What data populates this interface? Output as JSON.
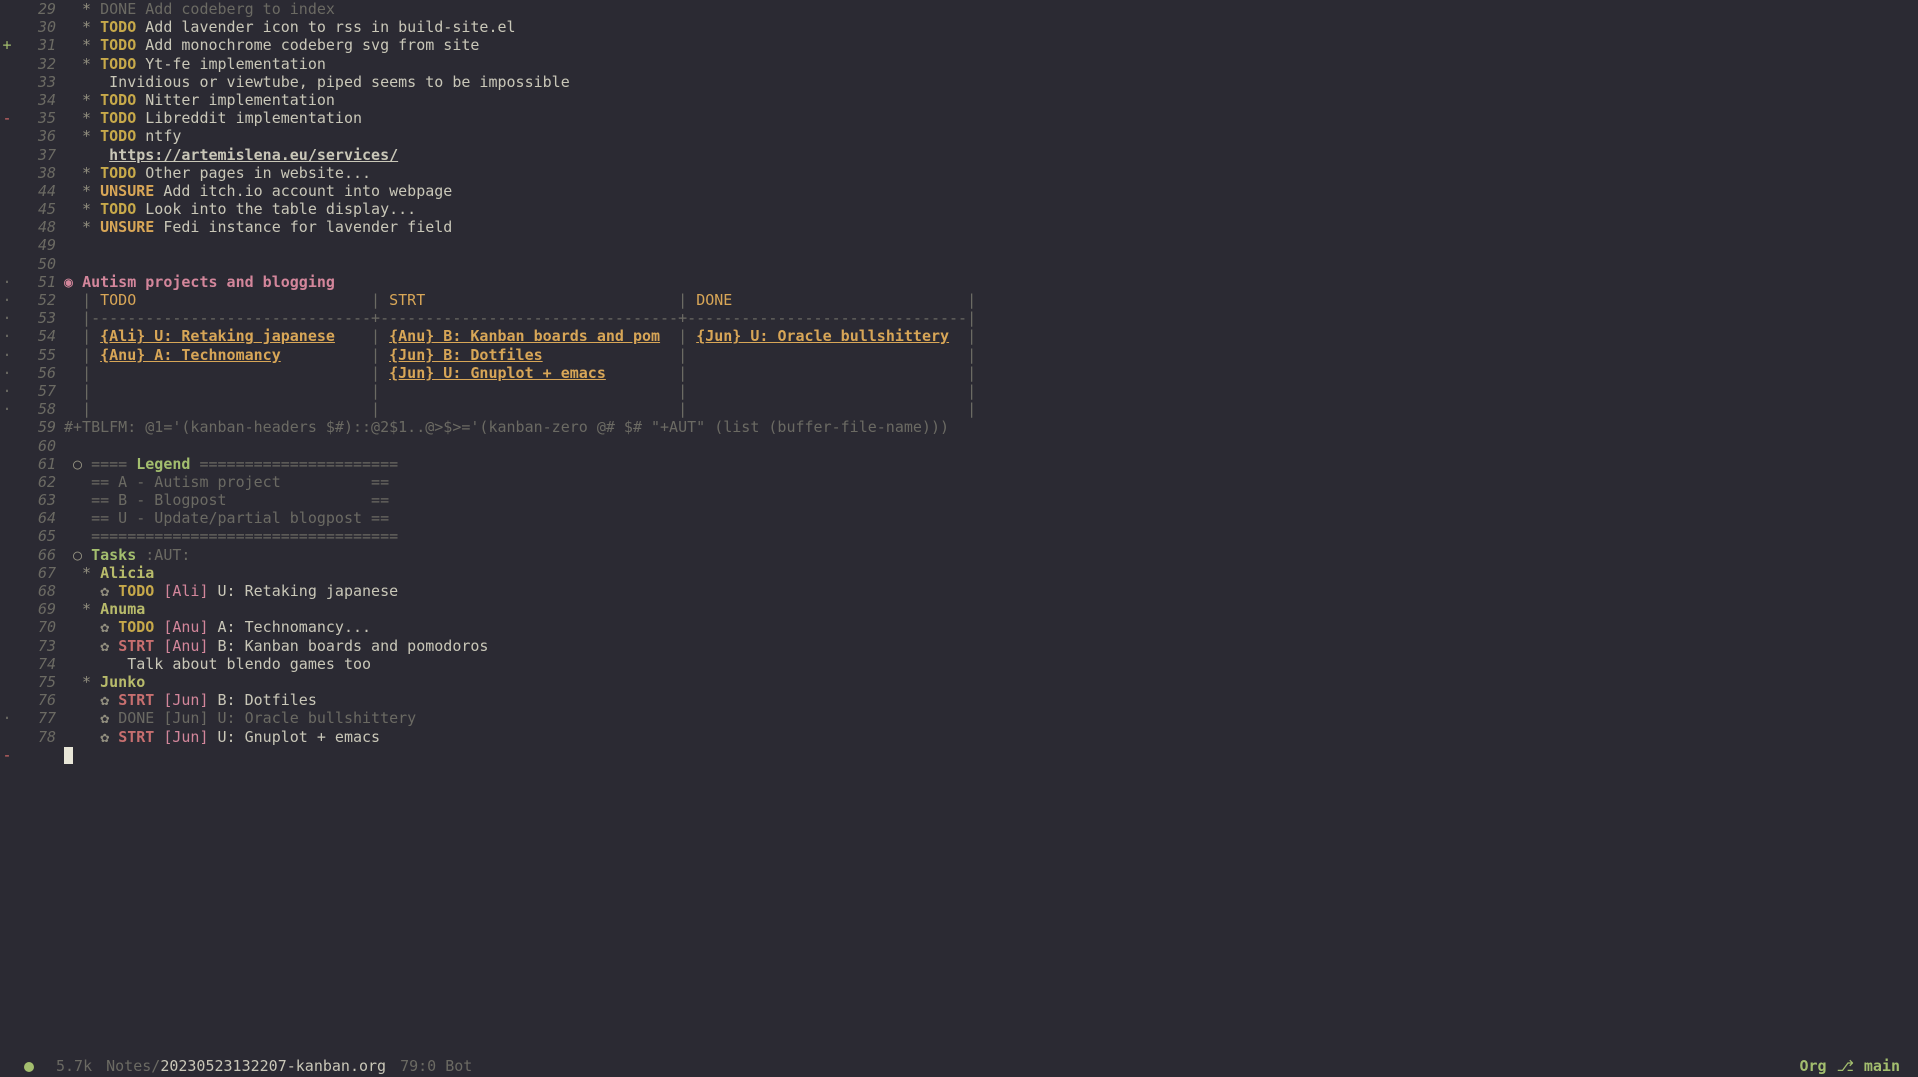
{
  "modeline": {
    "size": "5.7k",
    "path_prefix": "Notes/",
    "filename": "20230523132207-kanban.org",
    "position": "79:0 Bot",
    "mode": "Org",
    "branch": "main"
  },
  "lines": [
    {
      "num": "29",
      "diff": "",
      "bullet": "*",
      "kw": "DONE",
      "kwcls": "done",
      "text": "Add codeberg to index",
      "textcls": "done"
    },
    {
      "num": "30",
      "diff": "",
      "bullet": "*",
      "kw": "TODO",
      "kwcls": "todo",
      "text": "Add lavender icon to rss in build-site.el"
    },
    {
      "num": "31",
      "diff": "add",
      "bullet": "*",
      "kw": "TODO",
      "kwcls": "todo",
      "text": "Add monochrome codeberg svg from site"
    },
    {
      "num": "32",
      "diff": "",
      "bullet": "*",
      "kw": "TODO",
      "kwcls": "todo",
      "text": "Yt-fe implementation"
    },
    {
      "num": "33",
      "diff": "",
      "plain": "     Invidious or viewtube, piped seems to be impossible"
    },
    {
      "num": "34",
      "diff": "",
      "bullet": "*",
      "kw": "TODO",
      "kwcls": "todo",
      "text": "Nitter implementation"
    },
    {
      "num": "35",
      "diff": "del",
      "bullet": "*",
      "kw": "TODO",
      "kwcls": "todo",
      "text": "Libreddit implementation"
    },
    {
      "num": "36",
      "diff": "",
      "bullet": "*",
      "kw": "TODO",
      "kwcls": "todo",
      "text": "ntfy"
    },
    {
      "num": "37",
      "diff": "",
      "linkonly": "https://artemislena.eu/services/"
    },
    {
      "num": "38",
      "diff": "",
      "bullet": "*",
      "kw": "TODO",
      "kwcls": "todo",
      "text": "Other pages in website..."
    },
    {
      "num": "44",
      "diff": "",
      "bullet": "*",
      "kw": "UNSURE",
      "kwcls": "unsure",
      "text": "Add itch.io account into webpage"
    },
    {
      "num": "45",
      "diff": "",
      "bullet": "*",
      "kw": "TODO",
      "kwcls": "todo",
      "text": "Look into the table display..."
    },
    {
      "num": "48",
      "diff": "",
      "bullet": "*",
      "kw": "UNSURE",
      "kwcls": "unsure",
      "text": "Fedi instance for lavender field"
    },
    {
      "num": "49",
      "diff": "",
      "plain": ""
    },
    {
      "num": "50",
      "diff": "",
      "plain": ""
    },
    {
      "num": "51",
      "diff": "chg",
      "heading": "Autism projects and blogging",
      "bulletchar": "◉"
    },
    {
      "num": "52",
      "diff": "chg",
      "table": [
        "| ",
        "TODO",
        "                          | ",
        "STRT",
        "                            | ",
        "DONE",
        "                          |"
      ]
    },
    {
      "num": "53",
      "diff": "chg",
      "tablerule": "|-------------------------------+---------------------------------+-------------------------------|"
    },
    {
      "num": "54",
      "diff": "chg",
      "tablerow": [
        {
          "t": "| "
        },
        {
          "t": "{Ali} U: Retaking japanese",
          "l": true
        },
        {
          "t": "    | "
        },
        {
          "t": "{Anu} B: Kanban boards and pom",
          "l": true
        },
        {
          "t": "  | "
        },
        {
          "t": "{Jun} U: Oracle bullshittery",
          "l": true
        },
        {
          "t": "  |"
        }
      ]
    },
    {
      "num": "55",
      "diff": "chg",
      "tablerow": [
        {
          "t": "| "
        },
        {
          "t": "{Anu} A: Technomancy",
          "l": true
        },
        {
          "t": "          | "
        },
        {
          "t": "{Jun} B: Dotfiles",
          "l": true
        },
        {
          "t": "               |                               |"
        }
      ]
    },
    {
      "num": "56",
      "diff": "chg",
      "tablerow": [
        {
          "t": "|                               | "
        },
        {
          "t": "{Jun} U: Gnuplot + emacs",
          "l": true
        },
        {
          "t": "        |                               |"
        }
      ]
    },
    {
      "num": "57",
      "diff": "chg",
      "tablerow": [
        {
          "t": "|                               |                                 |                               |"
        }
      ]
    },
    {
      "num": "58",
      "diff": "chg",
      "tablerow": [
        {
          "t": "|                               |                                 |                               |"
        }
      ]
    },
    {
      "num": "59",
      "diff": "",
      "tblfm": "#+TBLFM: @1='(kanban-headers $#)::@2$1..@>$>='(kanban-zero @# $# \"+AUT\" (list (buffer-file-name)))"
    },
    {
      "num": "60",
      "diff": "",
      "plain": ""
    },
    {
      "num": "61",
      "diff": "",
      "legend_head": {
        "b": "○",
        "pre": "====",
        "title": "Legend",
        "post": "======================"
      }
    },
    {
      "num": "62",
      "diff": "",
      "legend": "   == A - Autism project          =="
    },
    {
      "num": "63",
      "diff": "",
      "legend": "   == B - Blogpost                =="
    },
    {
      "num": "64",
      "diff": "",
      "legend": "   == U - Update/partial blogpost =="
    },
    {
      "num": "65",
      "diff": "",
      "legend": "   =================================="
    },
    {
      "num": "66",
      "diff": "",
      "tasks_head": {
        "b": "○",
        "title": "Tasks",
        "tag": ":AUT:"
      }
    },
    {
      "num": "67",
      "diff": "",
      "bullet": "*",
      "star_green": true,
      "name": "Alicia"
    },
    {
      "num": "68",
      "diff": "",
      "sub": {
        "kw": "TODO",
        "kwcls": "todo",
        "tag": "[Ali]",
        "rest": "U: Retaking japanese"
      }
    },
    {
      "num": "69",
      "diff": "",
      "bullet": "*",
      "star_green": true,
      "name": "Anuma"
    },
    {
      "num": "70",
      "diff": "",
      "sub": {
        "kw": "TODO",
        "kwcls": "todo",
        "tag": "[Anu]",
        "rest": "A: Technomancy..."
      }
    },
    {
      "num": "73",
      "diff": "",
      "sub": {
        "kw": "STRT",
        "kwcls": "strt",
        "tag": "[Anu]",
        "rest": "B: Kanban boards and pomodoros"
      }
    },
    {
      "num": "74",
      "diff": "",
      "plain": "       Talk about blendo games too"
    },
    {
      "num": "75",
      "diff": "",
      "bullet": "*",
      "star_green": true,
      "name": "Junko"
    },
    {
      "num": "76",
      "diff": "",
      "sub": {
        "kw": "STRT",
        "kwcls": "strt",
        "tag": "[Jun]",
        "rest": "B: Dotfiles"
      }
    },
    {
      "num": "77",
      "diff": "chg",
      "sub": {
        "kw": "DONE",
        "kwcls": "done",
        "tag": "[Jun]",
        "rest": "U: Oracle bullshittery",
        "dim": true
      }
    },
    {
      "num": "78",
      "diff": "",
      "sub": {
        "kw": "STRT",
        "kwcls": "strt",
        "tag": "[Jun]",
        "rest": "U: Gnuplot + emacs"
      }
    }
  ]
}
